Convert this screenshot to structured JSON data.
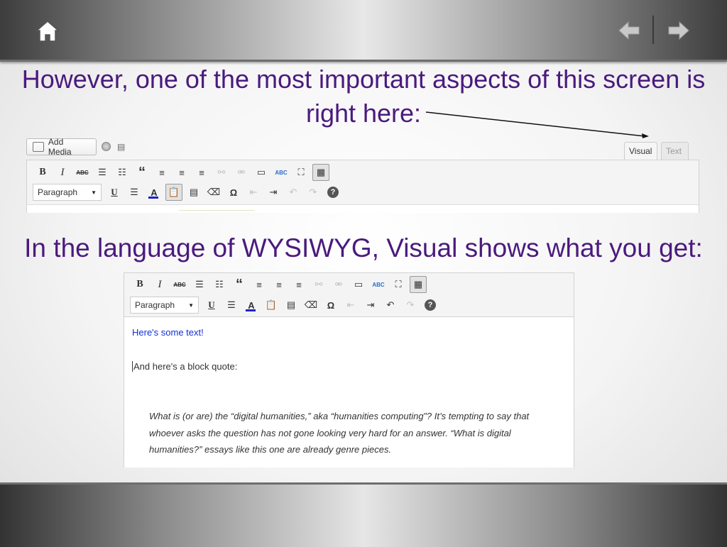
{
  "slide": {
    "heading_1": "However, one of the most important aspects of this screen is right here:",
    "heading_2": "In the language of WYSIWYG, Visual shows what you get:"
  },
  "nav": {
    "home_icon": "home-icon",
    "prev_icon": "arrow-left-icon",
    "next_icon": "arrow-right-icon"
  },
  "colors": {
    "heading": "#4a1a7e",
    "link_text": "#1030d8"
  },
  "editor_top": {
    "add_media_label": "Add Media",
    "tabs": [
      {
        "label": "Visual",
        "active": true
      },
      {
        "label": "Text",
        "active": false
      }
    ],
    "format_select": "Paragraph"
  },
  "editor_bottom": {
    "format_select": "Paragraph",
    "content": {
      "line1": "Here's some text!",
      "line2": "And here's a block quote:",
      "quote": "What is (or are) the “digital humanities,” aka “humanities computing”? It’s tempting to say that whoever asks the question has not gone looking very hard for an answer. “What is digital humanities?” essays like this one are already genre pieces."
    }
  },
  "toolbar": {
    "bold": "B",
    "italic": "I",
    "strike": "ABC",
    "blockquote": "“",
    "underline": "U",
    "text_color": "A",
    "special_char": "Ω",
    "help": "?",
    "spellcheck": "ABC"
  }
}
